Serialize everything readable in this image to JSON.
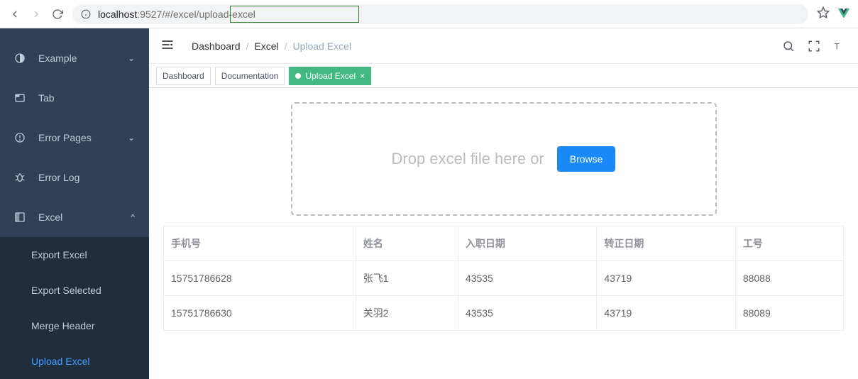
{
  "browser": {
    "url_host": "localhost",
    "url_port": ":9527",
    "url_path": "/#/excel/upload-excel"
  },
  "sidebar": {
    "items": [
      {
        "label": "Example",
        "icon": "example"
      },
      {
        "label": "Tab",
        "icon": "tab"
      },
      {
        "label": "Error Pages",
        "icon": "error"
      },
      {
        "label": "Error Log",
        "icon": "bug"
      },
      {
        "label": "Excel",
        "icon": "excel"
      }
    ],
    "excel_children": [
      {
        "label": "Export Excel"
      },
      {
        "label": "Export Selected"
      },
      {
        "label": "Merge Header"
      },
      {
        "label": "Upload Excel"
      }
    ]
  },
  "breadcrumb": {
    "items": [
      "Dashboard",
      "Excel",
      "Upload Excel"
    ]
  },
  "tags": [
    {
      "label": "Dashboard",
      "active": false,
      "closable": false
    },
    {
      "label": "Documentation",
      "active": false,
      "closable": false
    },
    {
      "label": "Upload Excel",
      "active": true,
      "closable": true
    }
  ],
  "dropzone": {
    "text": "Drop excel file here or",
    "button": "Browse"
  },
  "table": {
    "headers": [
      "手机号",
      "姓名",
      "入职日期",
      "转正日期",
      "工号"
    ],
    "rows": [
      [
        "15751786628",
        "张飞1",
        "43535",
        "43719",
        "88088"
      ],
      [
        "15751786630",
        "关羽2",
        "43535",
        "43719",
        "88089"
      ]
    ]
  },
  "colors": {
    "accent_green": "#42b983",
    "accent_blue": "#409eff",
    "sidebar_bg": "#304156"
  }
}
